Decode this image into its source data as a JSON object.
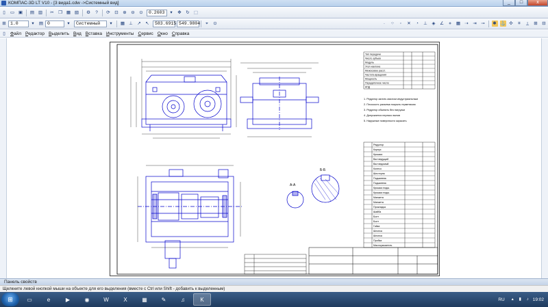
{
  "window": {
    "title": "КОМПАС-3D LT V10 - [3 вида1.cdw ->Системный вид]",
    "controls": [
      "_",
      "□",
      "x"
    ]
  },
  "toolbar1": {
    "zoom_value": "0.2603"
  },
  "toolbar2": {
    "line_scale": "1.0",
    "view_number": "0",
    "style_name": "Системный",
    "coord_x": "583.6915",
    "coord_y": "549.9804"
  },
  "menu": {
    "items": [
      "Файл",
      "Редактор",
      "Выделить",
      "Вид",
      "Вставка",
      "Инструменты",
      "Сервис",
      "Окно",
      "Справка"
    ]
  },
  "property_panel": {
    "label": "Панель свойств"
  },
  "status": {
    "text": "Щелкните левой кнопкой мыши на объекте для его выделения (вместе с Ctrl или Shift - добавить к выделенным)"
  },
  "taskbar": {
    "lang": "RU",
    "time": "19:02"
  },
  "drawing": {
    "table_rows": [
      "Тип передачи",
      "Число зубьев",
      "Модуль",
      "Угол наклона",
      "Межосевое расст.",
      "Частота вращения",
      "Мощность",
      "Передаточное число",
      "КПД"
    ],
    "spec_rows": [
      "Редуктор",
      "Корпус",
      "Крышка",
      "Вал ведущий",
      "Вал ведомый",
      "Колесо",
      "Шестерня",
      "Подшипник",
      "Подшипник",
      "Крышка подш.",
      "Крышка подш.",
      "Манжета",
      "Манжета",
      "Прокладка",
      "Шайба",
      "Болт",
      "Болт",
      "Гайка",
      "Шпонка",
      "Шпонка",
      "Пробка",
      "Маслоуказатель"
    ],
    "notes": [
      "1. Редуктор залить маслом индустриальным",
      "2. Плоскость разъема покрыть герметиком",
      "3. Редуктор обкатать без нагрузки",
      "4. Допускается перекос валов",
      "5. Наружные поверхности окрасить"
    ],
    "section_label_a": "А-А",
    "section_label_b": "Б-Б"
  },
  "colors": {
    "drawing_line": "#0000cc",
    "accent": "#2a5ab0"
  }
}
